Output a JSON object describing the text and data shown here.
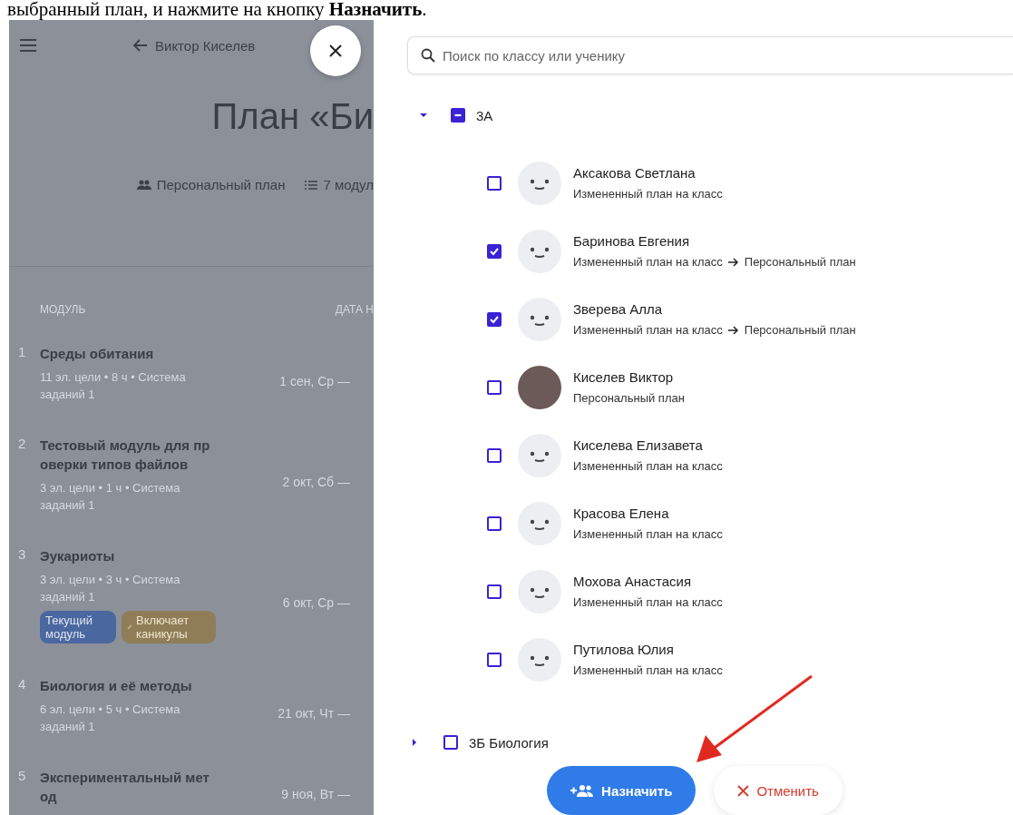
{
  "instruction": "выбранный план, и нажмите на кнопку **Назначить**.",
  "background_page": {
    "teacher_link": "Виктор Киселев",
    "title": "План «Би",
    "meta": [
      {
        "kind": "plan_type",
        "label": "Персональный план"
      },
      {
        "kind": "modules",
        "label": "7 модул"
      }
    ],
    "table": {
      "columns": [
        "МОДУЛЬ",
        "ДАТА Н"
      ],
      "rows": [
        {
          "number": "1",
          "title": "Среды обитания",
          "details": "11 эл. цели • 8 ч • Система заданий 1",
          "date": "1 сен, Ср —"
        },
        {
          "number": "2",
          "title": "Тестовый модуль для проверки типов файлов",
          "details": "3 эл. цели • 1 ч • Система заданий 1",
          "date": "2 окт, Сб —"
        },
        {
          "number": "3",
          "title": "Эукариоты",
          "details": "3 эл. цели • 3 ч • Система заданий 1",
          "date": "6 окт, Ср —",
          "badges": [
            {
              "kind": "current",
              "label": "Текущий модуль"
            },
            {
              "kind": "holiday",
              "label": "Включает каникулы"
            }
          ]
        },
        {
          "number": "4",
          "title": "Биология и её методы",
          "details": "6 эл. цели • 5 ч • Система заданий 1",
          "date": "21 окт, Чт —"
        },
        {
          "number": "5",
          "title": "Экспериментальный метод",
          "date": "9 ноя, Вт —"
        }
      ]
    }
  },
  "assign_panel": {
    "search": {
      "placeholder": "Поиск по классу или ученику"
    },
    "classes": [
      {
        "name": "3А",
        "expanded": true,
        "checked": false,
        "partial": true,
        "children": [
          {
            "name": "Аксакова Светлана",
            "kind": "default",
            "checked": false,
            "plan": "Измененный план на класс"
          },
          {
            "name": "Баринова Евгения",
            "kind": "default",
            "checked": true,
            "plan": "Измененный план на класс",
            "new_plan": "Персональный план"
          },
          {
            "name": "Зверева Алла",
            "kind": "default",
            "checked": true,
            "plan": "Измененный план на класс",
            "new_plan": "Персональный план"
          },
          {
            "name": "Киселев Виктор",
            "kind": "photo",
            "checked": false,
            "plan": "Персональный план"
          },
          {
            "name": "Киселева Елизавета",
            "kind": "default",
            "checked": false,
            "plan": "Измененный план на класс"
          },
          {
            "name": "Красова Елена",
            "kind": "default",
            "checked": false,
            "plan": "Измененный план на класс"
          },
          {
            "name": "Мохова Анастасия",
            "kind": "default",
            "checked": false,
            "plan": "Измененный план на класс"
          },
          {
            "name": "Путилова Юлия",
            "kind": "default",
            "checked": false,
            "plan": "Измененный план на класс"
          }
        ]
      },
      {
        "name": "3Б Биология",
        "expanded": false,
        "checked": false,
        "partial": false
      }
    ],
    "buttons": [
      {
        "kind": "primary",
        "label": "Назначить"
      },
      {
        "kind": "cancel",
        "label": "Отменить"
      }
    ]
  }
}
